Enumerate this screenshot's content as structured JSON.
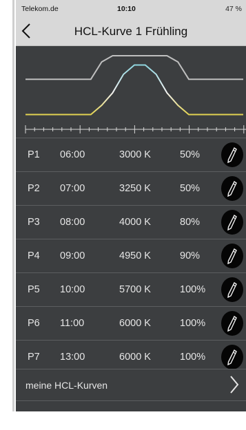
{
  "status_bar": {
    "carrier": "Telekom.de",
    "time": "10:10",
    "battery": "47 %"
  },
  "header": {
    "title": "HCL-Kurve 1 Frühling"
  },
  "chart_data": {
    "type": "line",
    "series": [
      {
        "values": [
          0.62,
          0.62,
          0.62,
          0.62,
          0.62,
          0.62,
          0.62,
          0.9,
          1.0,
          1.0,
          1.0,
          1.0,
          1.0,
          1.0,
          0.9,
          0.62,
          0.62,
          0.62,
          0.62,
          0.62,
          0.62
        ],
        "color": "#bfbfbf"
      },
      {
        "values": [
          0.05,
          0.05,
          0.05,
          0.05,
          0.05,
          0.05,
          0.05,
          0.2,
          0.4,
          0.7,
          0.85,
          0.85,
          0.7,
          0.4,
          0.2,
          0.05,
          0.05,
          0.05,
          0.05,
          0.05,
          0.05
        ],
        "color_low": "#e2d24f",
        "color_high": "#8fd6e0"
      }
    ]
  },
  "table": {
    "rows": [
      {
        "id": "P1",
        "time": "06:00",
        "temp": "3000 K",
        "pct": "50%"
      },
      {
        "id": "P2",
        "time": "07:00",
        "temp": "3250 K",
        "pct": "50%"
      },
      {
        "id": "P3",
        "time": "08:00",
        "temp": "4000 K",
        "pct": "80%"
      },
      {
        "id": "P4",
        "time": "09:00",
        "temp": "4950 K",
        "pct": "90%"
      },
      {
        "id": "P5",
        "time": "10:00",
        "temp": "5700 K",
        "pct": "100%"
      },
      {
        "id": "P6",
        "time": "11:00",
        "temp": "6000 K",
        "pct": "100%"
      },
      {
        "id": "P7",
        "time": "13:00",
        "temp": "6000 K",
        "pct": "100%"
      }
    ]
  },
  "footer": {
    "label": "meine HCL-Kurven"
  },
  "icons": {
    "back": "chevron-left-icon",
    "edit": "pencil-icon",
    "forward": "chevron-right-icon"
  }
}
